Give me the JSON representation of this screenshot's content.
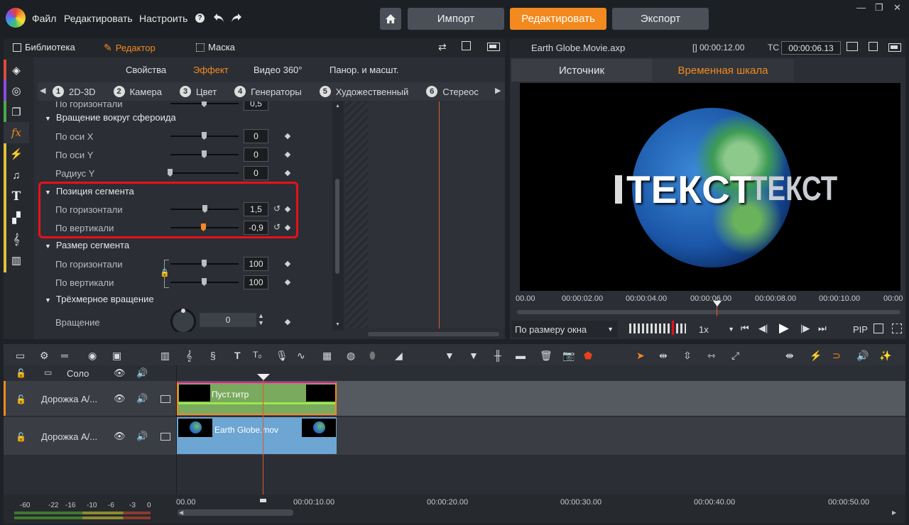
{
  "menu": {
    "file": "Файл",
    "edit": "Редактировать",
    "settings": "Настроить",
    "help_icon": "?"
  },
  "nav": {
    "import": "Импорт",
    "edit": "Редактировать",
    "export": "Экспорт"
  },
  "left_tabs": {
    "library": "Библиотека",
    "editor": "Редактор",
    "mask": "Маска"
  },
  "effect_tabs": {
    "properties": "Свойства",
    "effect": "Эффект",
    "video360": "Видео 360°",
    "pan": "Панор. и масшт."
  },
  "categories": [
    {
      "num": "1",
      "label": "2D-3D"
    },
    {
      "num": "2",
      "label": "Камера"
    },
    {
      "num": "3",
      "label": "Цвет"
    },
    {
      "num": "4",
      "label": "Генераторы"
    },
    {
      "num": "5",
      "label": "Художественный"
    },
    {
      "num": "6",
      "label": "Стереос"
    }
  ],
  "params": {
    "cut_top": {
      "label": "По горизонтали",
      "value": "0,5"
    },
    "group_rotation": "Вращение вокруг сфероида",
    "axis_x": {
      "label": "По оси X",
      "value": "0"
    },
    "axis_y": {
      "label": "По оси Y",
      "value": "0"
    },
    "radius_y": {
      "label": "Радиус Y",
      "value": "0"
    },
    "group_position": "Позиция сегмента",
    "pos_h": {
      "label": "По горизонтали",
      "value": "1,5"
    },
    "pos_v": {
      "label": "По вертикали",
      "value": "-0,9"
    },
    "group_size": "Размер сегмента",
    "size_h": {
      "label": "По горизонтали",
      "value": "100"
    },
    "size_v": {
      "label": "По вертикали",
      "value": "100"
    },
    "group_3d": "Трёхмерное вращение",
    "rotation": {
      "label": "Вращение",
      "value": "0"
    }
  },
  "preview": {
    "filename": "Earth Globe.Movie.axp",
    "duration": "[] 00:00:12.00",
    "tc_label": "TC",
    "timecode": "00:00:06.13",
    "tab_source": "Источник",
    "tab_timeline": "Временная шкала",
    "overlay_text": "ТЕКСТ",
    "ruler": [
      "00.00",
      "00:00:02.00",
      "00:00:04.00",
      "00:00:06.00",
      "00:00:08.00",
      "00:00:10.00",
      "00:00"
    ],
    "fit": "По размеру окна",
    "speed": "1x",
    "pip": "PIP"
  },
  "timeline": {
    "solo": "Соло",
    "tracks": [
      {
        "name": "Дорожка A/...",
        "clip": "Пуст.титр"
      },
      {
        "name": "Дорожка A/...",
        "clip": "Earth Globe.mov"
      }
    ],
    "ruler": [
      "00.00",
      "00:00:10.00",
      "00:00:20.00",
      "00:00:30.00",
      "00:00:40.00",
      "00:00:50.00"
    ],
    "meter": [
      "-60",
      "-22",
      "-16",
      "-10",
      "-6",
      "-3",
      "0"
    ]
  },
  "colors": {
    "accent": "#f28a1f",
    "highlight": "#e8101a",
    "title_clip": "#7aaa5e",
    "video_clip": "#6da5d3",
    "playhead": "#e2572a"
  }
}
